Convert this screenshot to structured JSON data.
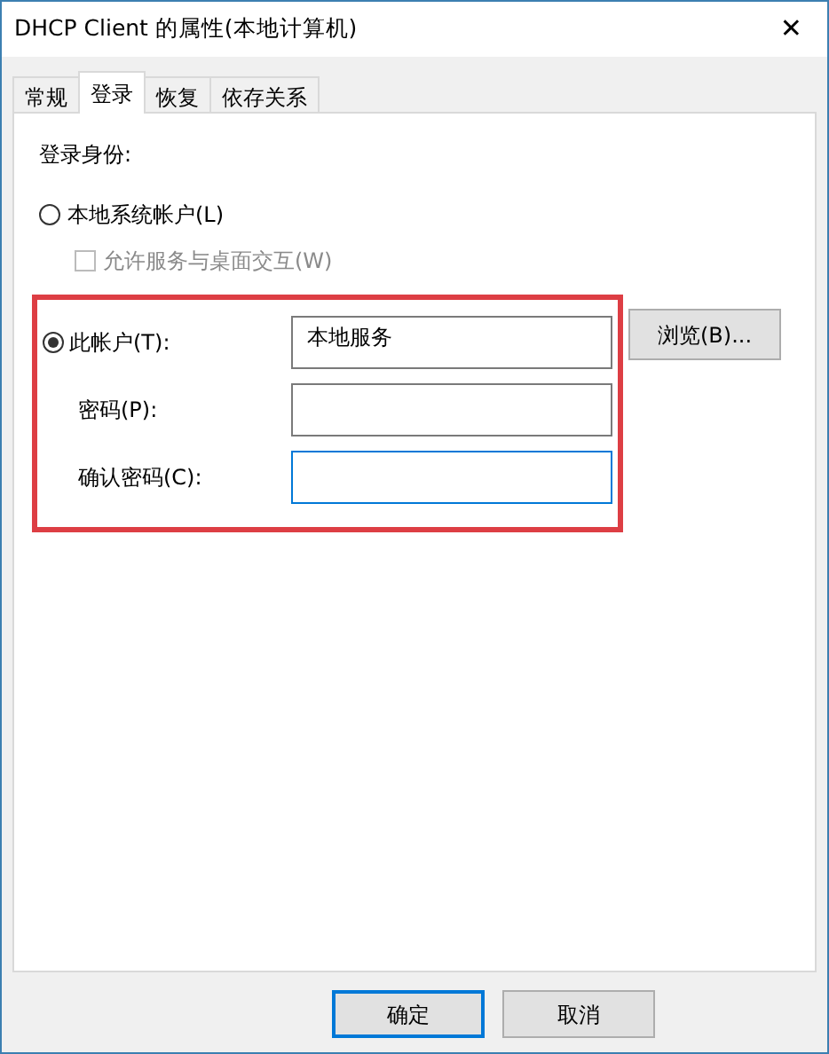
{
  "window": {
    "title": "DHCP Client 的属性(本地计算机)",
    "close": "✕"
  },
  "tabs": [
    {
      "label": "常规",
      "selected": false
    },
    {
      "label": "登录",
      "selected": true
    },
    {
      "label": "恢复",
      "selected": false
    },
    {
      "label": "依存关系",
      "selected": false
    }
  ],
  "logon": {
    "heading": "登录身份:",
    "local_system": {
      "label": "本地系统帐户(L)",
      "selected": false
    },
    "interact": {
      "label": "允许服务与桌面交互(W)",
      "checked": false,
      "disabled": true
    },
    "this_account": {
      "label": "此帐户(T):",
      "selected": true,
      "value": "本地服务"
    },
    "browse": "浏览(B)...",
    "fields": [
      {
        "label": "密码(P):",
        "focused": false
      },
      {
        "label": "确认密码(C):",
        "focused": true
      }
    ],
    "highlighted": true
  },
  "buttons": [
    {
      "label": "确定",
      "default": true
    },
    {
      "label": "取消",
      "default": false
    }
  ]
}
